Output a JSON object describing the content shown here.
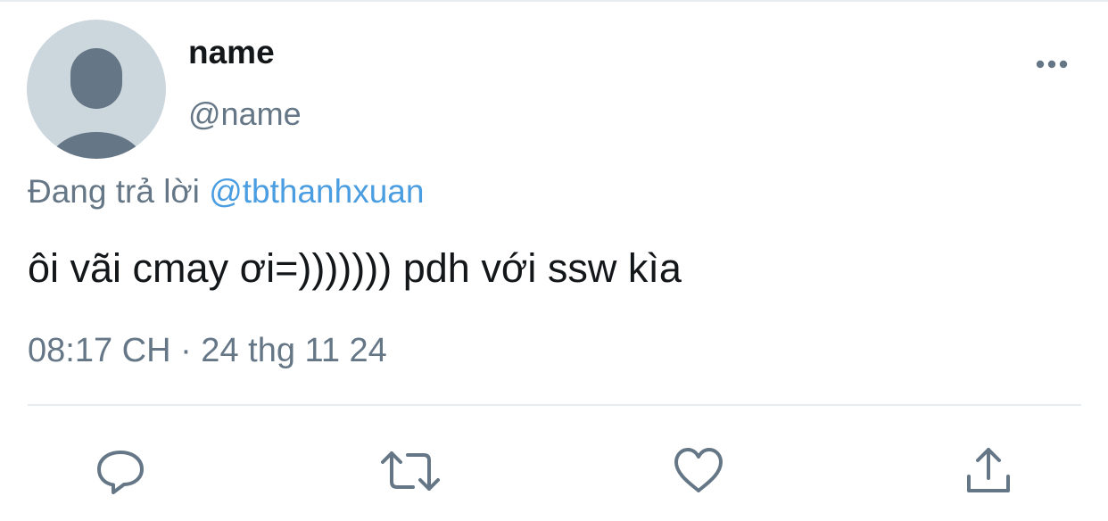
{
  "user": {
    "display_name": "name",
    "handle": "@name"
  },
  "tweet": {
    "reply_prefix": "Đang trả lời ",
    "reply_to": "@tbthanhxuan",
    "text": "ôi vãi cmay ơi=))))))) pdh với ssw kìa",
    "timestamp": "08:17 CH · 24 thg 11 24"
  },
  "icons": {
    "avatar": "default-avatar-icon",
    "more": "more-options-icon",
    "reply": "reply-icon",
    "retweet": "retweet-icon",
    "like": "heart-icon",
    "share": "share-icon"
  },
  "colors": {
    "text": "#14171a",
    "secondary": "#657786",
    "link": "#4a9de0",
    "avatar_bg": "#ccd6dd",
    "avatar_fg": "#657786",
    "divider": "#e6ecf0"
  }
}
